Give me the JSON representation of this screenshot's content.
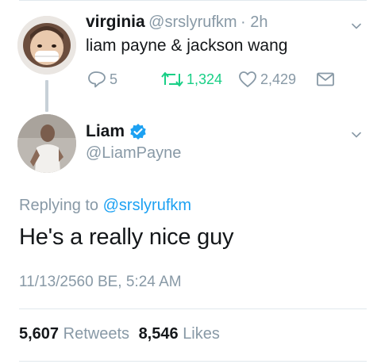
{
  "reply_tweet": {
    "user_name": "virginia",
    "handle": "@srslyrufkm",
    "time": "· 2h",
    "text": "liam payne & jackson wang",
    "actions": {
      "replies": "5",
      "retweets": "1,324",
      "likes": "2,429"
    }
  },
  "main_tweet": {
    "user_name": "Liam",
    "handle": "@LiamPayne",
    "replying_prefix": "Replying to",
    "replying_handle": "@srslyrufkm",
    "text": "He's a really nice guy",
    "timestamp": "11/13/2560 BE, 5:24 AM",
    "stats": {
      "retweets_count": "5,607",
      "retweets_label": "Retweets",
      "likes_count": "8,546",
      "likes_label": "Likes"
    }
  },
  "colors": {
    "link": "#1da1f2",
    "retweet": "#19cf86",
    "muted": "#8899a6",
    "text": "#14171a"
  },
  "icons": [
    "reply-icon",
    "retweet-icon",
    "like-icon",
    "dm-icon",
    "chevron-down-icon",
    "verified-icon"
  ]
}
